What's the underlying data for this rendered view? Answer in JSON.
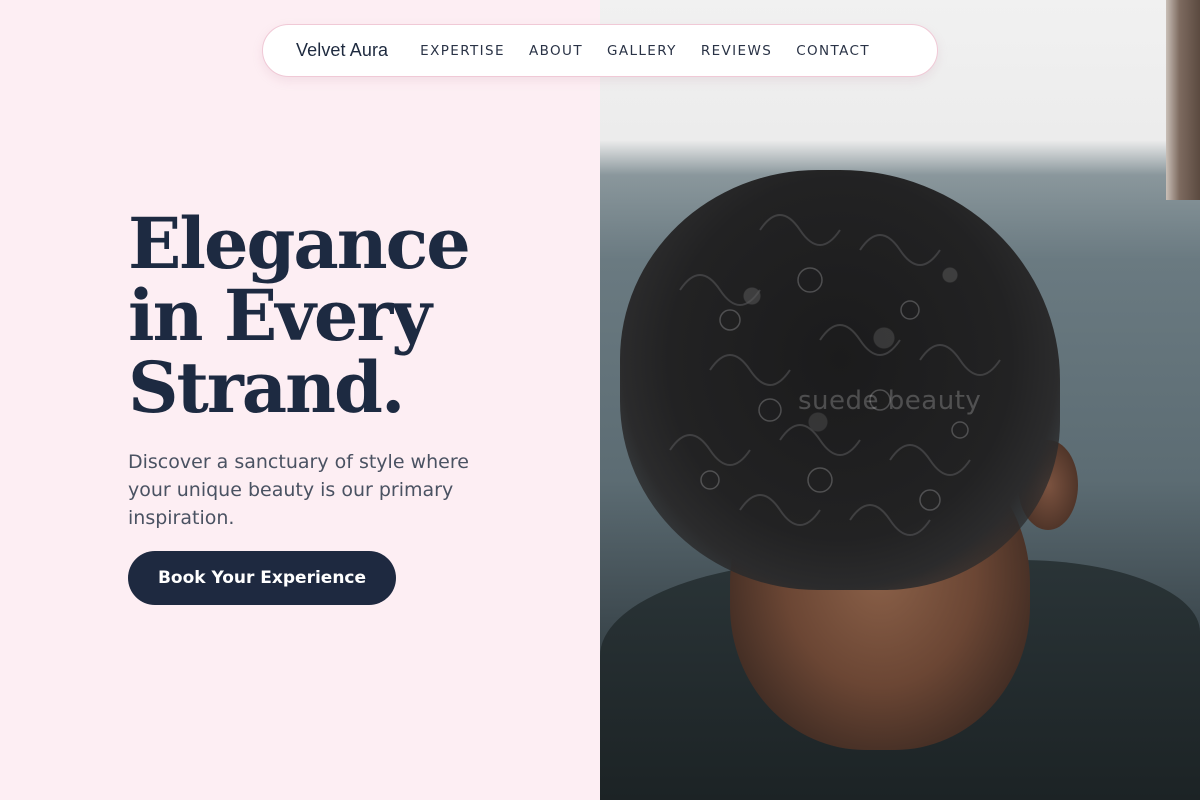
{
  "nav": {
    "brand": "Velvet Aura",
    "links": [
      "EXPERTISE",
      "ABOUT",
      "GALLERY",
      "REVIEWS",
      "CONTACT"
    ]
  },
  "hero": {
    "headline_lines": [
      "Elegance",
      "in Every",
      "Strand."
    ],
    "subtext": "Discover a sanctuary of style where your unique beauty is our primary inspiration.",
    "cta_label": "Book Your Experience",
    "image_watermark": "suede beauty"
  },
  "colors": {
    "left_background": "#fdeef3",
    "heading": "#1d2a41",
    "button": "#1e2940",
    "nav_border": "#f0c9d6"
  }
}
